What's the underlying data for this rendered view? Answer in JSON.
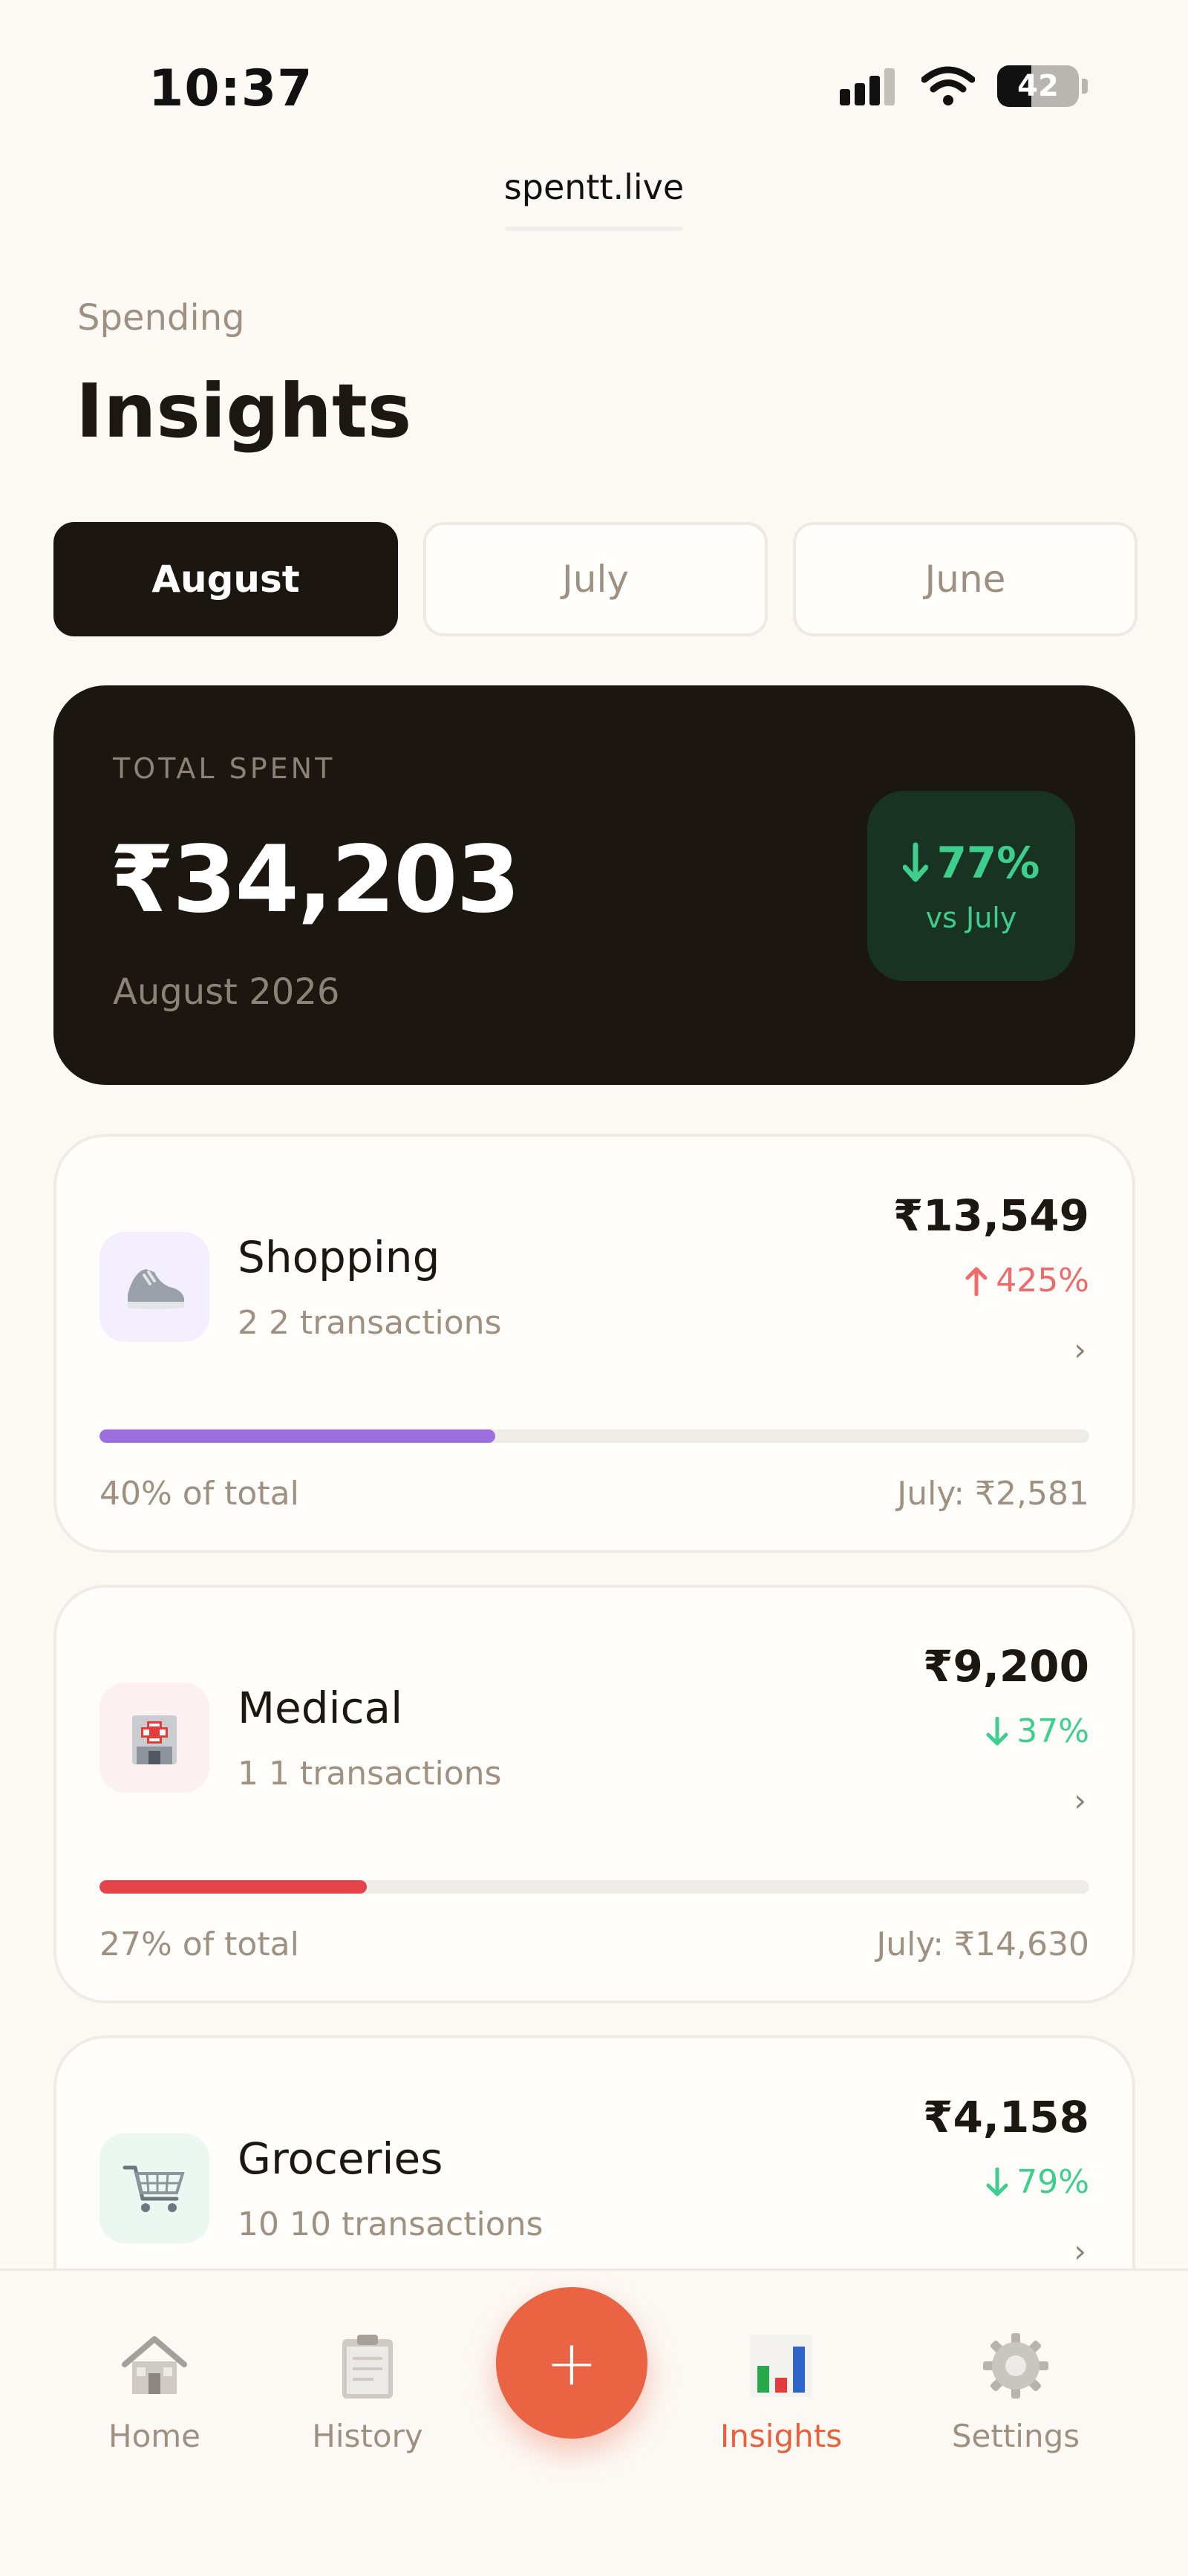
{
  "status_bar": {
    "time": "10:37",
    "battery": "42",
    "battery_level": 0.42
  },
  "url": "spentt.live",
  "header": {
    "eyebrow": "Spending",
    "title": "Insights"
  },
  "month_tabs": [
    {
      "label": "August",
      "active": true
    },
    {
      "label": "July",
      "active": false
    },
    {
      "label": "June",
      "active": false
    }
  ],
  "total": {
    "label": "TOTAL SPENT",
    "amount": "₹34,203",
    "period": "August 2026",
    "change": "77%",
    "change_direction": "down",
    "compare": "vs July"
  },
  "categories": [
    {
      "name": "Shopping",
      "count": "2 2 transactions",
      "amount": "₹13,549",
      "change": "425%",
      "direction": "up",
      "share_label": "40% of total",
      "share": 40,
      "prev": "July: ₹2,581",
      "bar_color": "#9b6fe0",
      "icon_bg": "#f3effe",
      "icon": "sneaker-icon",
      "chevron": "›"
    },
    {
      "name": "Medical",
      "count": "1 1 transactions",
      "amount": "₹9,200",
      "change": "37%",
      "direction": "down",
      "share_label": "27% of total",
      "share": 27,
      "prev": "July: ₹14,630",
      "bar_color": "#e5434a",
      "icon_bg": "#fdf0f0",
      "icon": "hospital-icon",
      "chevron": "›"
    },
    {
      "name": "Groceries",
      "count": "10 10 transactions",
      "amount": "₹4,158",
      "change": "79%",
      "direction": "down",
      "icon_bg": "#eaf8f1",
      "icon": "shopping-cart-icon",
      "chevron": "›"
    }
  ],
  "nav": {
    "items": [
      {
        "label": "Home",
        "icon": "house-icon",
        "active": false
      },
      {
        "label": "History",
        "icon": "clipboard-icon",
        "active": false
      },
      {
        "label": "Insights",
        "icon": "bar-chart-icon",
        "active": true
      },
      {
        "label": "Settings",
        "icon": "gear-icon",
        "active": false
      }
    ],
    "add_label": "+"
  },
  "colors": {
    "accent": "#ea6443",
    "dark": "#1c1610",
    "positive": "#3ecf8e",
    "negative": "#ef6b6b"
  }
}
